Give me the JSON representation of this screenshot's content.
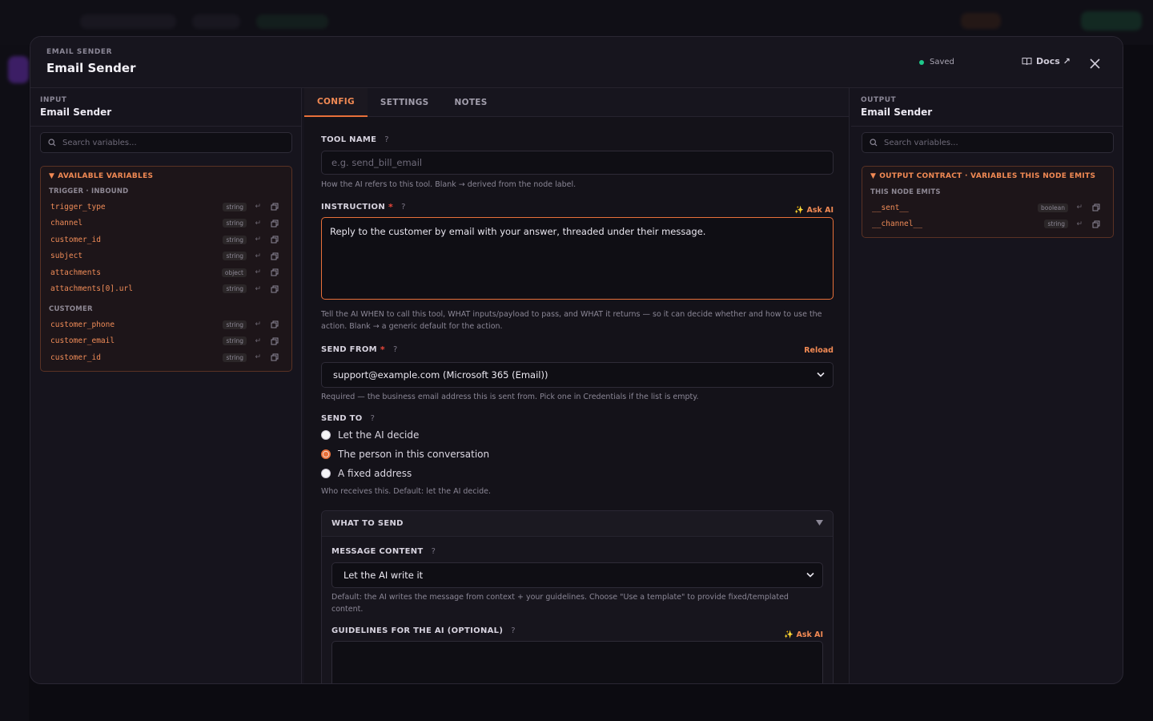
{
  "modal": {
    "kicker": "EMAIL SENDER",
    "title": "Email Sender",
    "status": "Saved",
    "docs_label": "Docs ↗"
  },
  "input_panel": {
    "kicker": "INPUT",
    "title": "Email Sender",
    "search_placeholder": "Search variables...",
    "box_title": "AVAILABLE VARIABLES",
    "groups": [
      {
        "label": "TRIGGER · INBOUND",
        "vars": [
          {
            "name": "trigger_type",
            "type": "string"
          },
          {
            "name": "channel",
            "type": "string"
          },
          {
            "name": "customer_id",
            "type": "string"
          },
          {
            "name": "subject",
            "type": "string"
          },
          {
            "name": "attachments",
            "type": "object"
          },
          {
            "name": "attachments[0].url",
            "type": "string"
          }
        ]
      },
      {
        "label": "CUSTOMER",
        "vars": [
          {
            "name": "customer_phone",
            "type": "string"
          },
          {
            "name": "customer_email",
            "type": "string"
          },
          {
            "name": "customer_id",
            "type": "string"
          }
        ]
      }
    ]
  },
  "tabs": [
    "CONFIG",
    "SETTINGS",
    "NOTES"
  ],
  "config": {
    "tool_name": {
      "label": "TOOL NAME",
      "placeholder": "e.g. send_bill_email",
      "help": "How the AI refers to this tool. Blank → derived from the node label."
    },
    "instruction": {
      "label": "INSTRUCTION",
      "ask_ai": "✨ Ask AI",
      "value": "Reply to the customer by email with your answer, threaded under their message.",
      "help": "Tell the AI WHEN to call this tool, WHAT inputs/payload to pass, and WHAT it returns — so it can decide whether and how to use the action. Blank → a generic default for the action."
    },
    "send_from": {
      "label": "SEND FROM",
      "reload": "Reload",
      "value": "support@example.com (Microsoft 365 (Email))",
      "help": "Required — the business email address this is sent from. Pick one in Credentials if the list is empty."
    },
    "send_to": {
      "label": "SEND TO",
      "options": [
        "Let the AI decide",
        "The person in this conversation",
        "A fixed address"
      ],
      "selected": 1,
      "help": "Who receives this. Default: let the AI decide."
    },
    "what_to_send": {
      "title": "WHAT TO SEND",
      "message_content_label": "MESSAGE CONTENT",
      "message_content_value": "Let the AI write it",
      "message_help": "Default: the AI writes the message from context + your guidelines. Choose \"Use a template\" to provide fixed/templated content.",
      "guidelines_label": "GUIDELINES FOR THE AI (OPTIONAL)",
      "ask_ai": "✨ Ask AI"
    }
  },
  "output_panel": {
    "kicker": "OUTPUT",
    "title": "Email Sender",
    "search_placeholder": "Search variables...",
    "box_title": "OUTPUT CONTRACT · VARIABLES THIS NODE EMITS",
    "group_label": "THIS NODE EMITS",
    "vars": [
      {
        "name": "__sent__",
        "type": "boolean"
      },
      {
        "name": "__channel__",
        "type": "string"
      }
    ]
  },
  "colors": {
    "accent": "#e8703a",
    "accent_text": "#f28a54",
    "saved_dot": "#1ec98b",
    "required": "#e8463a"
  }
}
